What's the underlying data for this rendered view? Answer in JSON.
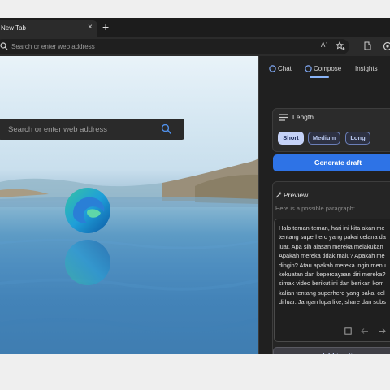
{
  "tab": {
    "title": "New Tab",
    "close_icon": "×",
    "new_tab_icon": "+"
  },
  "address_bar": {
    "placeholder": "Search or enter web address",
    "read_aloud_icon": "Aʾ"
  },
  "page": {
    "search_placeholder": "Search or enter web address"
  },
  "sidebar": {
    "tabs": [
      {
        "label": "Chat"
      },
      {
        "label": "Compose"
      },
      {
        "label": "Insights"
      }
    ],
    "active_tab": "Compose",
    "length": {
      "title": "Length",
      "options": [
        "Short",
        "Medium",
        "Long"
      ],
      "selected": "Short"
    },
    "generate_label": "Generate draft",
    "preview": {
      "title": "Preview",
      "hint": "Here is a possible paragraph:",
      "text": "Halo teman-teman, hari ini kita akan me\ntentang superhero yang pakai celana da\nluar. Apa sih alasan mereka melakukan\nApakah mereka tidak malu? Apakah me\ndingin? Atau apakah mereka ingin menu\nkekuatan dan kepercayaan diri mereka?\nsimak video berikut ini dan berikan kom\nkalian tentang superhero yang pakai cel\ndi luar. Jangan lupa like, share dan subs"
    },
    "add_label": "Add to site"
  },
  "colors": {
    "accent": "#2e73e6",
    "sidebar_bg": "#202020",
    "pill_active": "#c5d2f7"
  }
}
